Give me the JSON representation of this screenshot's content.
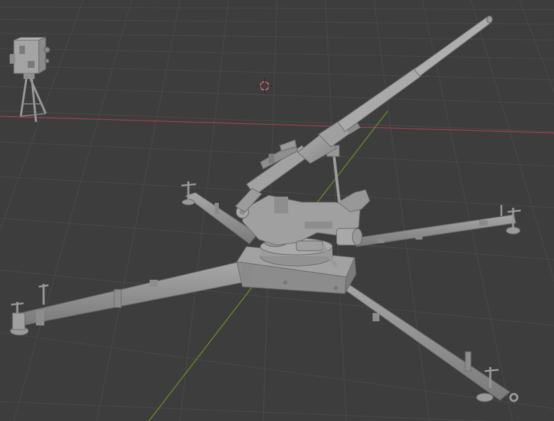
{
  "viewport": {
    "background": "#3d3d3d",
    "grid_color": "#4a4a4a",
    "axis_x_color": "#a3404c",
    "axis_y_color": "#6f9628",
    "model_color": "#9c9c9c",
    "model_shade": "#7d7d7d",
    "model_dark": "#5e5e5e",
    "cursor_color": "#d8d8d8",
    "cursor_accent": "#c0404a"
  },
  "scene": {
    "objects": [
      {
        "name": "anti-aircraft-gun"
      },
      {
        "name": "rangefinder-on-tripod"
      }
    ]
  }
}
